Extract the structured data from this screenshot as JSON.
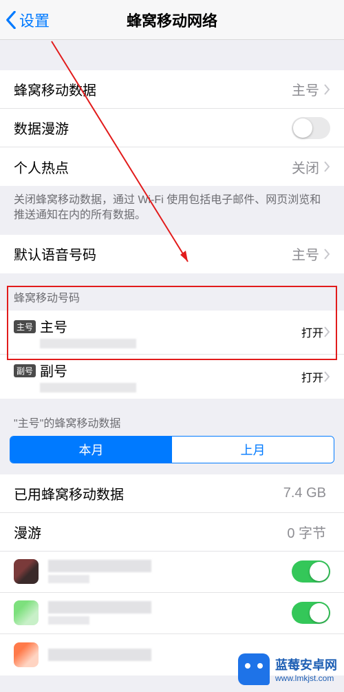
{
  "nav": {
    "back_label": "设置",
    "title": "蜂窝移动网络"
  },
  "group1": {
    "cellular_data": {
      "label": "蜂窝移动数据",
      "value": "主号"
    },
    "roaming": {
      "label": "数据漫游",
      "on": false
    },
    "hotspot": {
      "label": "个人热点",
      "value": "关闭"
    },
    "footer": "关闭蜂窝移动数据，通过 Wi-Fi 使用包括电子邮件、网页浏览和推送通知在内的所有数据。"
  },
  "group2": {
    "default_voice": {
      "label": "默认语音号码",
      "value": "主号"
    }
  },
  "plans": {
    "header": "蜂窝移动号码",
    "items": [
      {
        "badge": "主号",
        "title": "主号",
        "status": "打开"
      },
      {
        "badge": "副号",
        "title": "副号",
        "status": "打开"
      }
    ]
  },
  "usage": {
    "header": "\"主号\"的蜂窝移动数据",
    "segments": {
      "current": "本月",
      "previous": "上月",
      "active": "current"
    },
    "used": {
      "label": "已用蜂窝移动数据",
      "value": "7.4 GB"
    },
    "roam": {
      "label": "漫游",
      "value": "0 字节"
    }
  },
  "apps": [
    {
      "icon": "a",
      "on": true
    },
    {
      "icon": "b",
      "on": true
    },
    {
      "icon": "c",
      "on": true
    }
  ],
  "watermark": {
    "title": "蓝莓安卓网",
    "url": "www.lmkjst.com"
  }
}
